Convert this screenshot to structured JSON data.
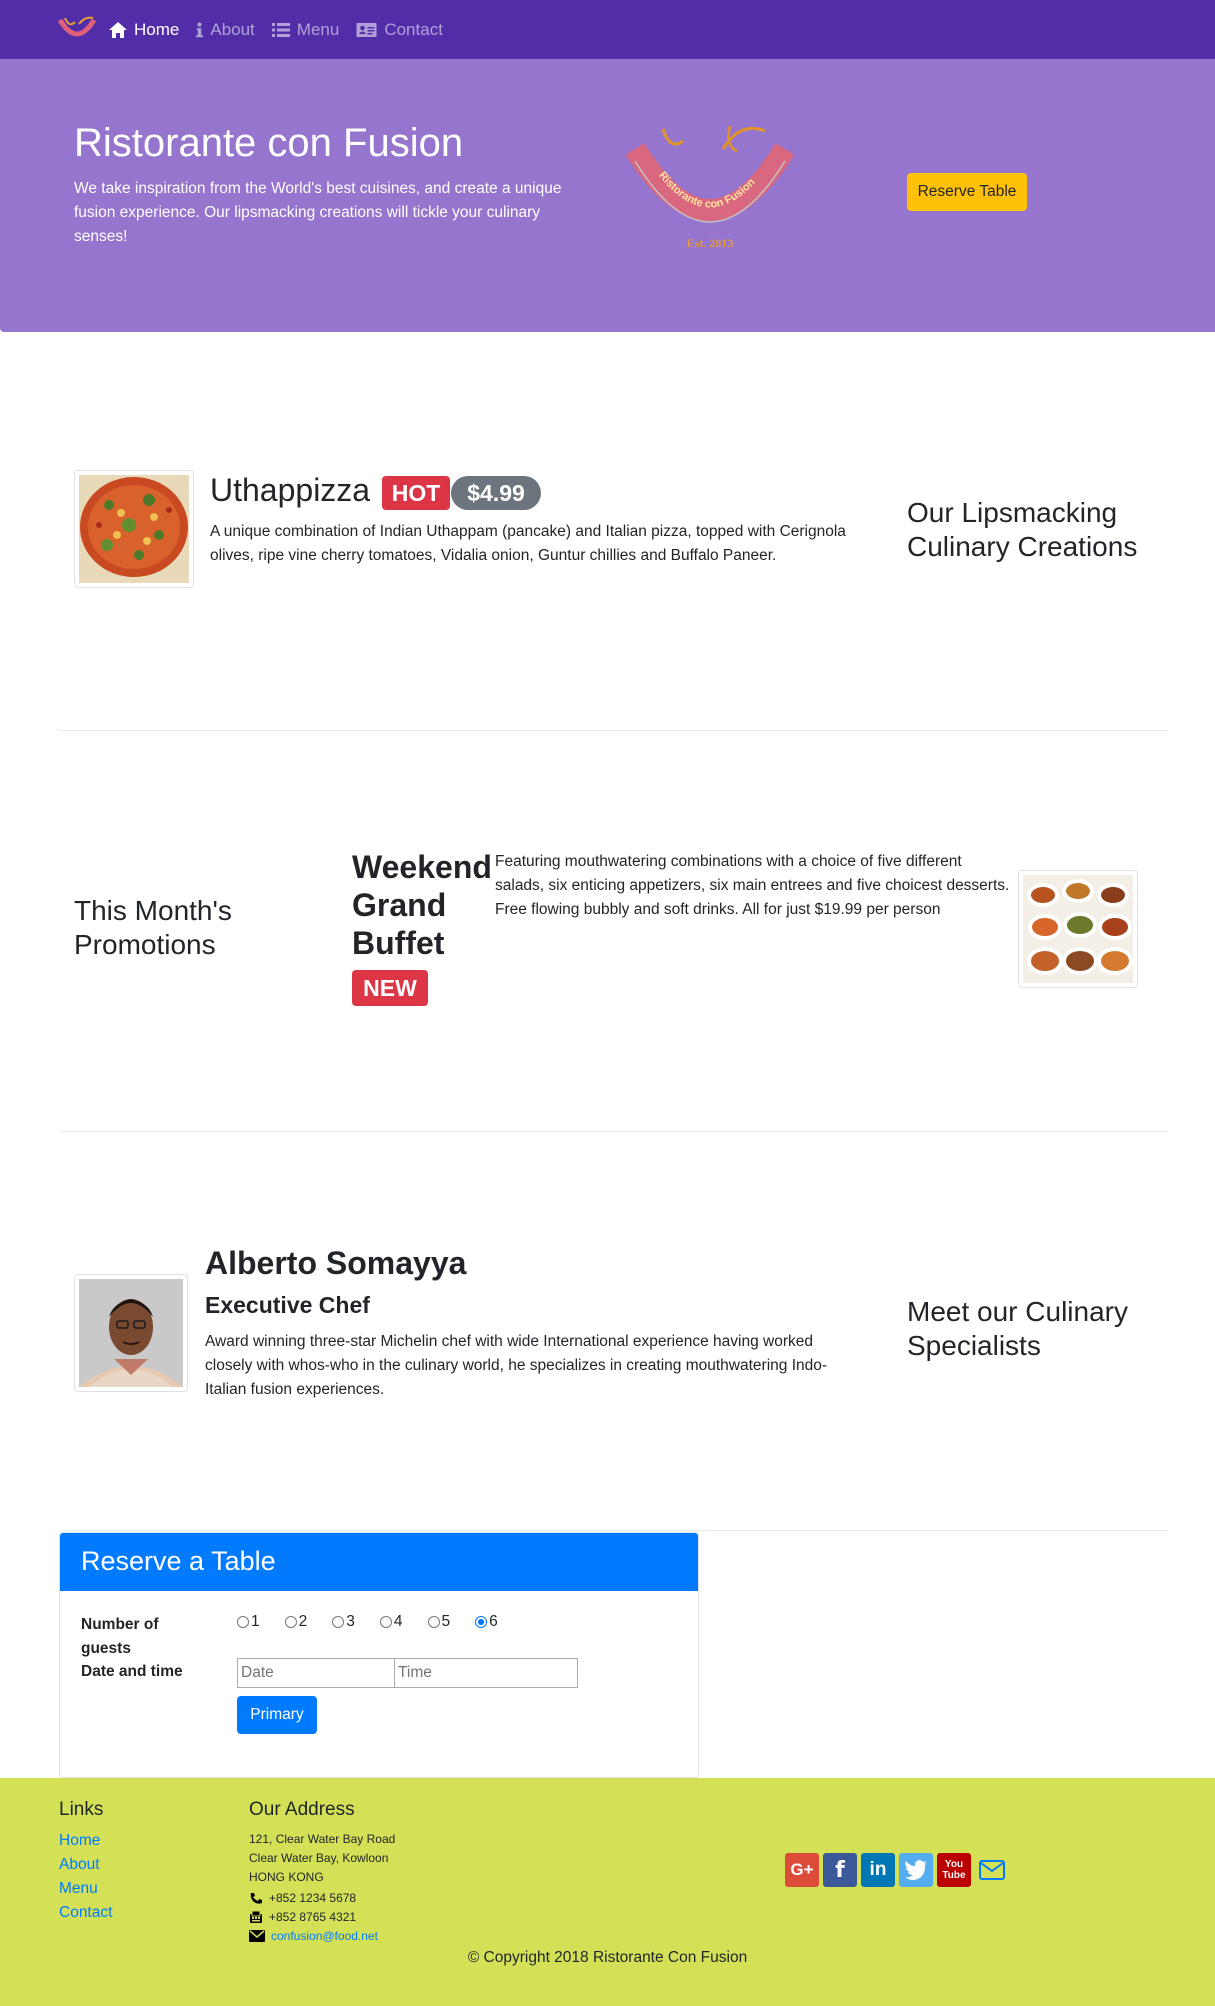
{
  "nav": {
    "items": [
      {
        "label": "Home",
        "icon": "home-icon",
        "active": true
      },
      {
        "label": "About",
        "icon": "info-icon",
        "active": false
      },
      {
        "label": "Menu",
        "icon": "list-icon",
        "active": false
      },
      {
        "label": "Contact",
        "icon": "address-card-icon",
        "active": false
      }
    ]
  },
  "jumbotron": {
    "title": "Ristorante con Fusion",
    "text": "We take inspiration from the World's best cuisines, and create a unique fusion experience. Our lipsmacking creations will tickle your culinary senses!",
    "logo_text": "Ristorante con Fusion",
    "logo_est": "Est. 2013",
    "reserve_button": "Reserve Table"
  },
  "dish": {
    "name": "Uthappizza",
    "label": "HOT",
    "price": "$4.99",
    "description": "A unique combination of Indian Uthappam (pancake) and Italian pizza, topped with Cerignola olives, ripe vine cherry tomatoes, Vidalia onion, Guntur chillies and Buffalo Paneer.",
    "section_title": "Our Lipsmacking Culinary Creations"
  },
  "promotion": {
    "section_title": "This Month's Promotions",
    "name": "Weekend Grand Buffet",
    "label": "NEW",
    "description": "Featuring mouthwatering combinations with a choice of five different salads, six enticing appetizers, six main entrees and five choicest desserts. Free flowing bubbly and soft drinks. All for just $19.99 per person"
  },
  "leader": {
    "name": "Alberto Somayya",
    "designation": "Executive Chef",
    "description": "Award winning three-star Michelin chef with wide International experience having worked closely with whos-who in the culinary world, he specializes in creating mouthwatering Indo-Italian fusion experiences.",
    "section_title": "Meet our Culinary Specialists"
  },
  "reservation": {
    "title": "Reserve a Table",
    "guests_label": "Number of guests",
    "datetime_label": "Date and time",
    "guest_options": [
      "1",
      "2",
      "3",
      "4",
      "5",
      "6"
    ],
    "selected_guests": "6",
    "date_placeholder": "Date",
    "time_placeholder": "Time",
    "submit": "Primary"
  },
  "footer": {
    "links_title": "Links",
    "links": [
      "Home",
      "About",
      "Menu",
      "Contact"
    ],
    "address_title": "Our Address",
    "address_lines": [
      "121, Clear Water Bay Road",
      "Clear Water Bay, Kowloon",
      "HONG KONG"
    ],
    "phone": "+852 1234 5678",
    "fax": "+852 8765 4321",
    "email": "confusion@food.net",
    "social": [
      "google-plus-icon",
      "facebook-icon",
      "linkedin-icon",
      "twitter-icon",
      "youtube-icon",
      "mail-icon"
    ],
    "copyright": "© Copyright 2018 Ristorante Con Fusion"
  },
  "colors": {
    "navbar": "#512DA8",
    "jumbotron": "#9575CD",
    "footer": "#D4E157",
    "accent": "#ffc107",
    "primary": "#007bff",
    "danger": "#dc3545"
  }
}
